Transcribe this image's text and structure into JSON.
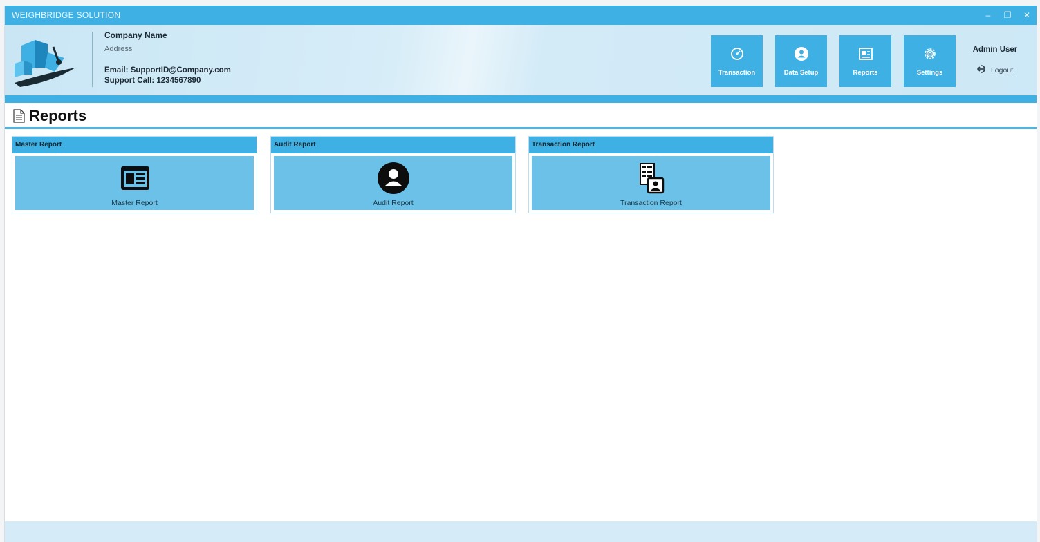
{
  "window": {
    "title": "WEIGHBRIDGE SOLUTION",
    "controls": [
      "–",
      "❐",
      "✕"
    ]
  },
  "company": {
    "name": "Company Name",
    "address": "Address",
    "email": "Email: SupportID@Company.com",
    "support_call": "Support Call: 1234567890"
  },
  "nav": {
    "transaction": "Transaction",
    "data_setup": "Data Setup",
    "reports": "Reports",
    "settings": "Settings"
  },
  "user": {
    "name": "Admin User",
    "logout": "Logout"
  },
  "page": {
    "title": "Reports"
  },
  "cards": [
    {
      "header": "Master Report",
      "label": "Master Report",
      "icon": "newspaper-icon"
    },
    {
      "header": "Audit Report",
      "label": "Audit Report",
      "icon": "user-circle-icon"
    },
    {
      "header": "Transaction Report",
      "label": "Transaction Report",
      "icon": "document-user-icon"
    }
  ],
  "colors": {
    "accent": "#3fb0e3",
    "tile": "#6cc1e8",
    "header_bg": "#d3ebf7"
  }
}
